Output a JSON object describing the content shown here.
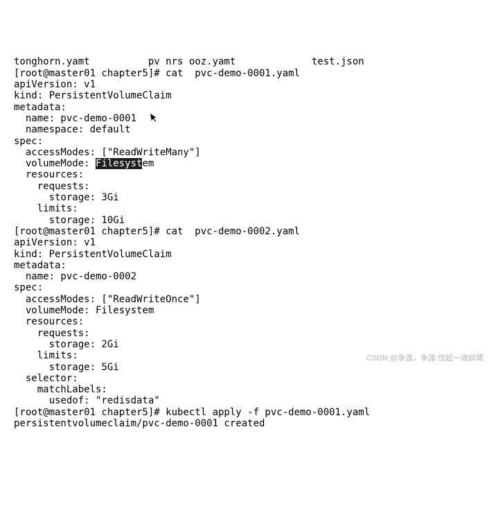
{
  "lines": {
    "l0": "tonghorn.yamt          pv nrs ooz.yamt             test.json",
    "l1": "[root@master01 chapter5]# cat  pvc-demo-0001.yaml",
    "l2": "apiVersion: v1",
    "l3": "kind: PersistentVolumeClaim",
    "l4": "metadata:",
    "l5": "  name: pvc-demo-0001",
    "l6": "  namespace: default",
    "l7": "spec:",
    "l8": "  accessModes: [\"ReadWriteMany\"]",
    "l9a": "  volumeMode: ",
    "l9b": "Filesyst",
    "l9c": "em",
    "l10": "  resources:",
    "l11": "    requests:",
    "l12": "      storage: 3Gi",
    "l13": "    limits:",
    "l14": "      storage: 10Gi",
    "l15": "[root@master01 chapter5]# cat  pvc-demo-0002.yaml",
    "l16": "apiVersion: v1",
    "l17": "kind: PersistentVolumeClaim",
    "l18": "metadata:",
    "l19": "  name: pvc-demo-0002",
    "l20": "spec:",
    "l21": "  accessModes: [\"ReadWriteOnce\"]",
    "l22": "  volumeMode: Filesystem",
    "l23": "  resources:",
    "l24": "    requests:",
    "l25": "      storage: 2Gi",
    "l26": "    limits:",
    "l27": "      storage: 5Gi",
    "l28": "  selector:",
    "l29": "    matchLabels:",
    "l30": "      usedof: \"redisdata\"",
    "l31": "[root@master01 chapter5]# kubectl apply -f pvc-demo-0001.yaml",
    "l32": "persistentvolumeclaim/pvc-demo-0001 created"
  },
  "watermark": "CSDN @争渡，争渡 惊起一滩鸥鹭"
}
